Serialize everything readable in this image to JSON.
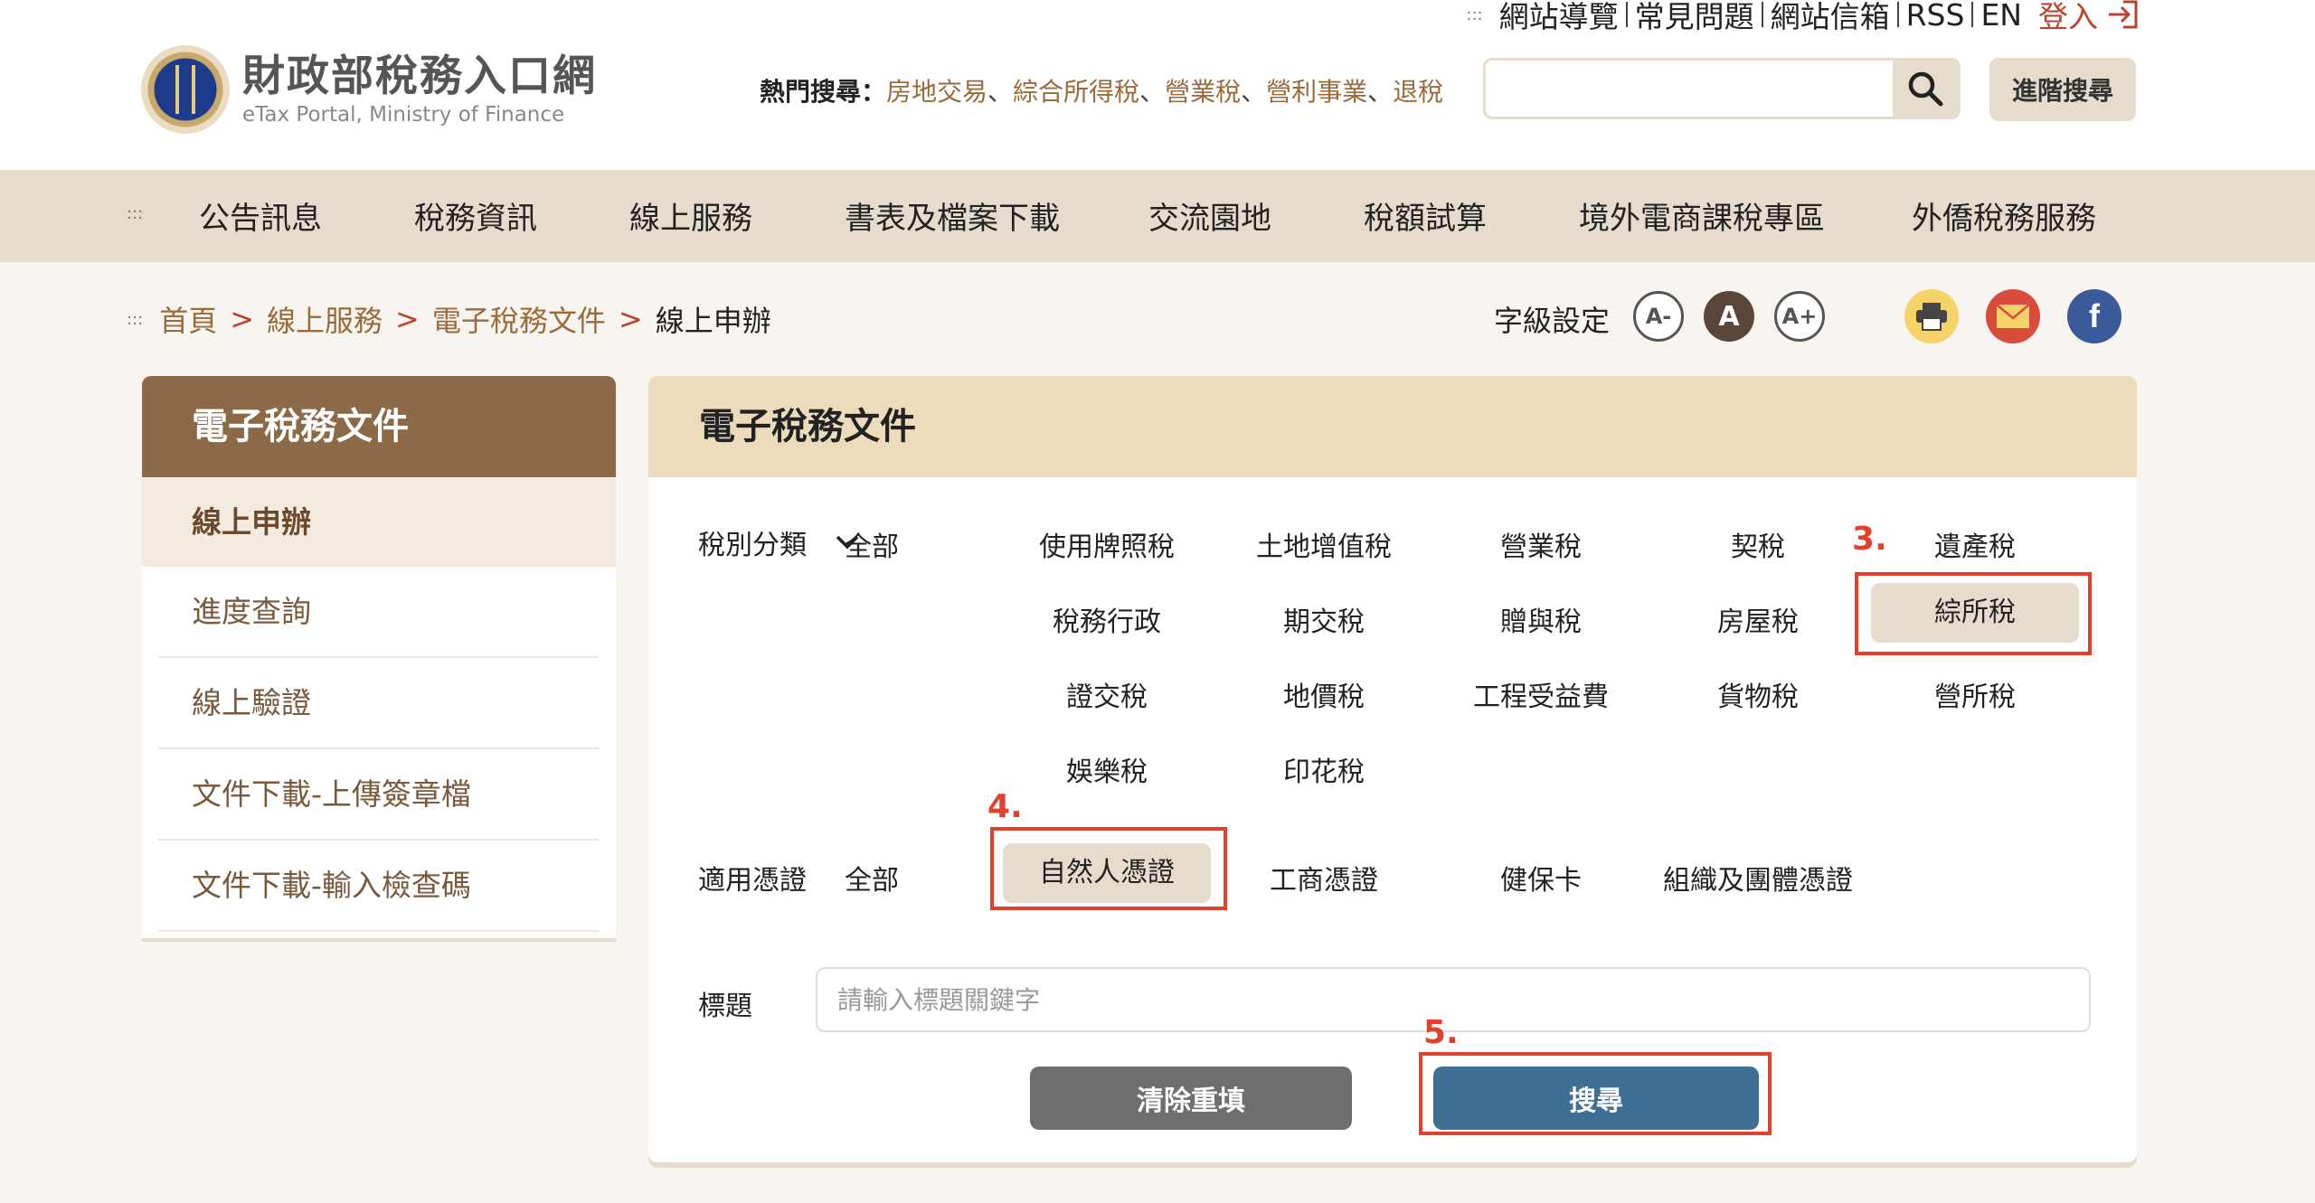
{
  "logo": {
    "title": "財政部稅務入口網",
    "subtitle": "eTax Portal, Ministry of Finance"
  },
  "top_links": [
    "網站導覽",
    "常見問題",
    "網站信箱",
    "RSS",
    "EN"
  ],
  "login_label": "登入",
  "hot_search": {
    "label": "熱門搜尋：",
    "keywords": [
      "房地交易",
      "綜合所得稅",
      "營業稅",
      "營利事業",
      "退稅"
    ]
  },
  "search": {
    "placeholder": "",
    "advanced_label": "進階搜尋"
  },
  "nav": [
    "公告訊息",
    "稅務資訊",
    "線上服務",
    "書表及檔案下載",
    "交流園地",
    "稅額試算",
    "境外電商課稅專區",
    "外僑稅務服務"
  ],
  "breadcrumb": [
    "首頁",
    "線上服務",
    "電子稅務文件",
    "線上申辦"
  ],
  "font_setting": {
    "label": "字級設定",
    "buttons": [
      "A-",
      "A",
      "A+"
    ]
  },
  "sidebar": {
    "title": "電子稅務文件",
    "items": [
      "線上申辦",
      "進度查詢",
      "線上驗證",
      "文件下載-上傳簽章檔",
      "文件下載-輸入檢查碼"
    ]
  },
  "main": {
    "title": "電子稅務文件",
    "tax_label": "稅別分類",
    "tax_all": "全部",
    "tax_rows": [
      [
        "使用牌照稅",
        "土地增值稅",
        "營業稅",
        "契稅",
        "遺產稅"
      ],
      [
        "稅務行政",
        "期交稅",
        "贈與稅",
        "房屋稅",
        "綜所稅"
      ],
      [
        "證交稅",
        "地價稅",
        "工程受益費",
        "貨物稅",
        "營所稅"
      ],
      [
        "娛樂稅",
        "印花稅"
      ]
    ],
    "cert_label": "適用憑證",
    "cert_all": "全部",
    "certs": [
      "自然人憑證",
      "工商憑證",
      "健保卡",
      "組織及團體憑證"
    ],
    "title_label": "標題",
    "title_placeholder": "請輸入標題關鍵字",
    "clear_label": "清除重填",
    "search_label": "搜尋"
  },
  "steps": [
    "3.",
    "4.",
    "5."
  ]
}
